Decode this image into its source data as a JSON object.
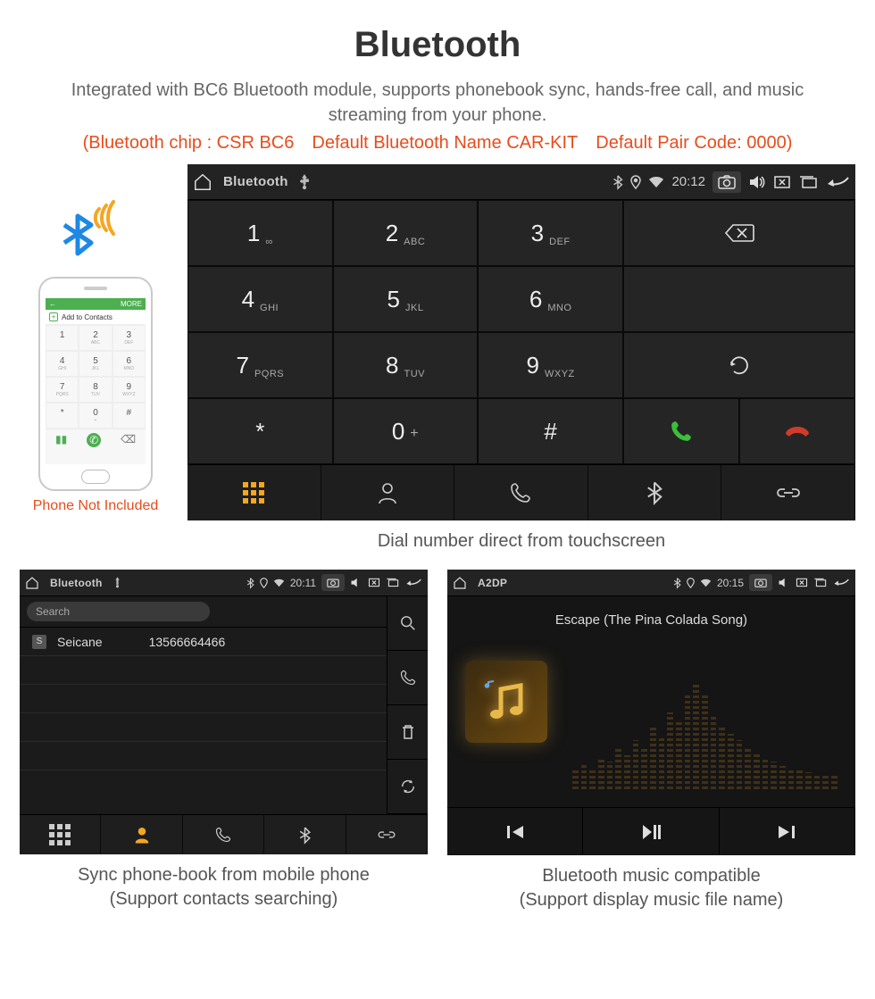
{
  "page": {
    "title": "Bluetooth",
    "description": "Integrated with BC6 Bluetooth module, supports phonebook sync, hands-free call, and music streaming from your phone.",
    "spec": "(Bluetooth chip : CSR BC6 Default Bluetooth Name CAR-KIT Default Pair Code: 0000)"
  },
  "phone": {
    "mini_bar_left": "",
    "add_contacts": "Add to Contacts",
    "more": "MORE",
    "caption": "Phone Not Included"
  },
  "dialer": {
    "app_title": "Bluetooth",
    "time": "20:12",
    "keys": [
      {
        "n": "1",
        "s": "∞"
      },
      {
        "n": "2",
        "s": "ABC"
      },
      {
        "n": "3",
        "s": "DEF"
      },
      {
        "n": "4",
        "s": "GHI"
      },
      {
        "n": "5",
        "s": "JKL"
      },
      {
        "n": "6",
        "s": "MNO"
      },
      {
        "n": "7",
        "s": "PQRS"
      },
      {
        "n": "8",
        "s": "TUV"
      },
      {
        "n": "9",
        "s": "WXYZ"
      },
      {
        "n": "*",
        "s": ""
      },
      {
        "n": "0",
        "s": "+"
      },
      {
        "n": "#",
        "s": ""
      }
    ],
    "caption": "Dial number direct from touchscreen"
  },
  "contacts": {
    "app_title": "Bluetooth",
    "time": "20:11",
    "search_placeholder": "Search",
    "row_badge": "S",
    "row_name": "Seicane",
    "row_number": "13566664466",
    "caption_l1": "Sync phone-book from mobile phone",
    "caption_l2": "(Support contacts searching)"
  },
  "music": {
    "app_title": "A2DP",
    "time": "20:15",
    "track": "Escape (The Pina Colada Song)",
    "caption_l1": "Bluetooth music compatible",
    "caption_l2": "(Support display music file name)"
  }
}
